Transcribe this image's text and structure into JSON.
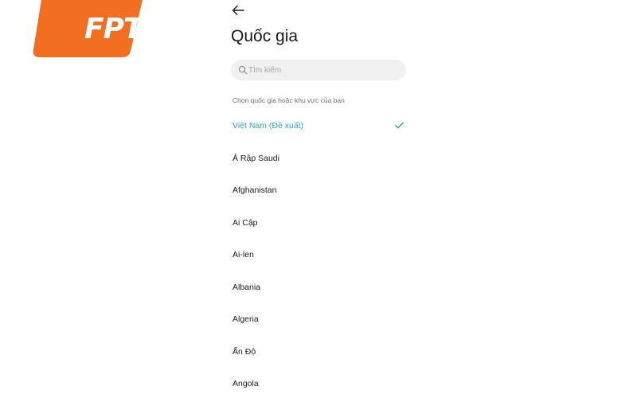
{
  "colors": {
    "brand_orange": "#f26f21",
    "accent": "#2aa8bd",
    "text_primary": "#1a1a1a",
    "text_secondary": "#6e6e73",
    "search_bg": "#f1f1f2"
  },
  "brand": {
    "logo_text": "FPT",
    "registered_mark": "®"
  },
  "header": {
    "back_icon": "arrow-left-icon",
    "title": "Quốc gia"
  },
  "search": {
    "icon": "search-icon",
    "placeholder": "Tìm kiếm",
    "value": ""
  },
  "list": {
    "section_label": "Chọn quốc gia hoặc khu vực của bạn",
    "selected_icon": "check-icon",
    "items": [
      {
        "label": "Việt Nam (Đề xuất)",
        "selected": true
      },
      {
        "label": "Ả Rập Saudi",
        "selected": false
      },
      {
        "label": "Afghanistan",
        "selected": false
      },
      {
        "label": "Ai Cập",
        "selected": false
      },
      {
        "label": "Ai-len",
        "selected": false
      },
      {
        "label": "Albania",
        "selected": false
      },
      {
        "label": "Algeria",
        "selected": false
      },
      {
        "label": "Ấn Độ",
        "selected": false
      },
      {
        "label": "Angola",
        "selected": false
      }
    ]
  }
}
